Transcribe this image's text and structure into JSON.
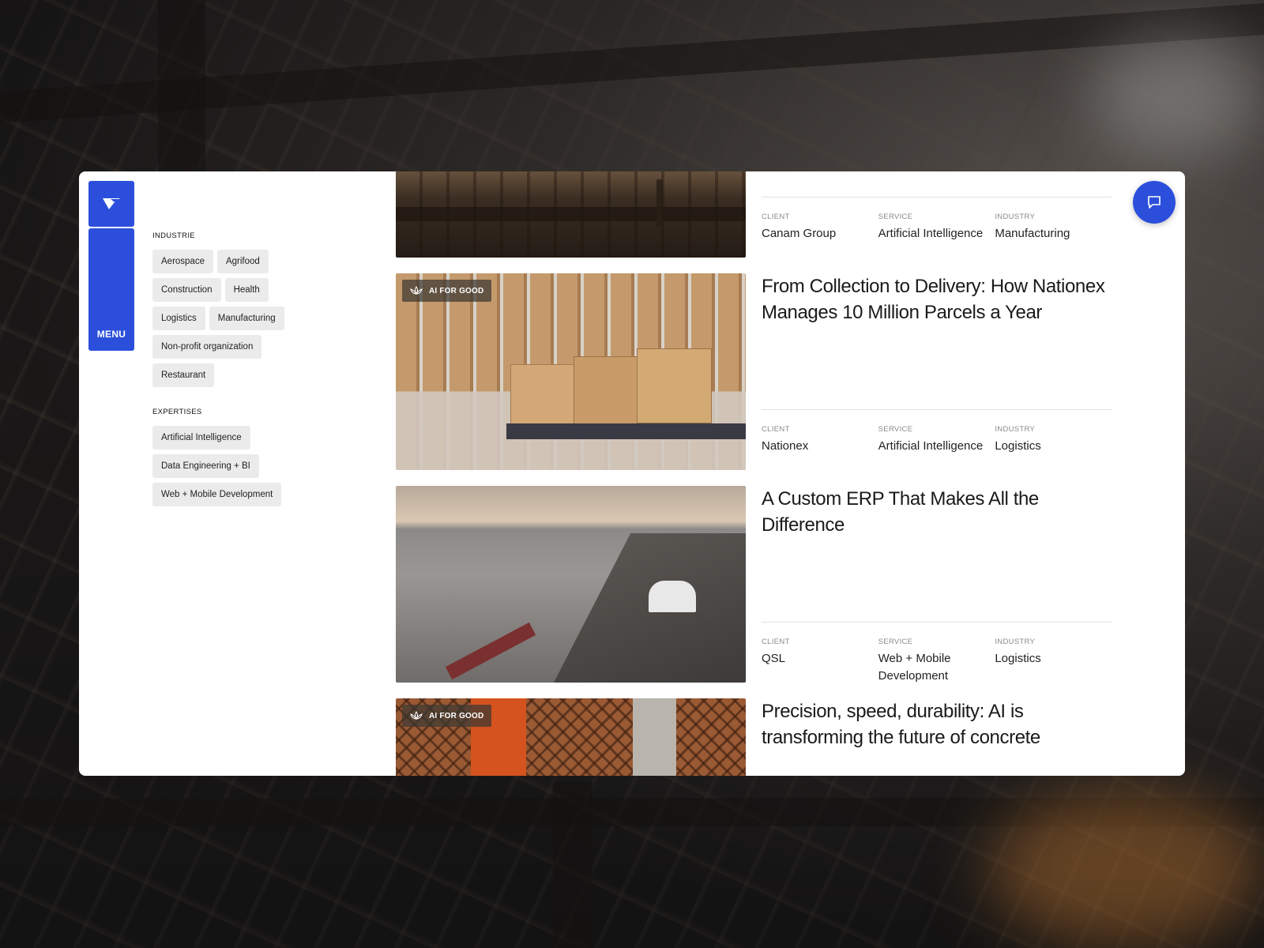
{
  "nav": {
    "menu_label": "MENU",
    "logo_icon": "company-logo-icon",
    "chat_icon": "chat-bubble-icon"
  },
  "filters": {
    "industry_heading": "INDUSTRIE",
    "industries": [
      "Aerospace",
      "Agrifood",
      "Construction",
      "Health",
      "Logistics",
      "Manufacturing",
      "Non-profit organization",
      "Restaurant"
    ],
    "expertise_heading": "EXPERTISES",
    "expertises": [
      "Artificial Intelligence",
      "Data Engineering + BI",
      "Web + Mobile Development"
    ]
  },
  "meta_labels": {
    "client": "CLIENT",
    "service": "SERVICE",
    "industry": "INDUSTRY"
  },
  "cases": [
    {
      "title": "",
      "badge": "",
      "client": "Canam Group",
      "service": "Artificial Intelligence",
      "industry": "Manufacturing"
    },
    {
      "title": "From Collection to Delivery: How Nationex Manages 10 Million Parcels a Year",
      "badge": "AI FOR GOOD",
      "client": "Nationex",
      "service": "Artificial Intelligence",
      "industry": "Logistics"
    },
    {
      "title": "A Custom ERP That Makes All the Difference",
      "badge": "",
      "client": "QSL",
      "service": "Web + Mobile Development",
      "industry": "Logistics"
    },
    {
      "title": "Precision, speed, durability: AI is transforming the future of concrete",
      "badge": "AI FOR GOOD",
      "client": "",
      "service": "",
      "industry": ""
    }
  ],
  "colors": {
    "accent": "#2b4fdb",
    "chip_bg": "#ebebeb",
    "panel_bg": "#ffffff"
  }
}
